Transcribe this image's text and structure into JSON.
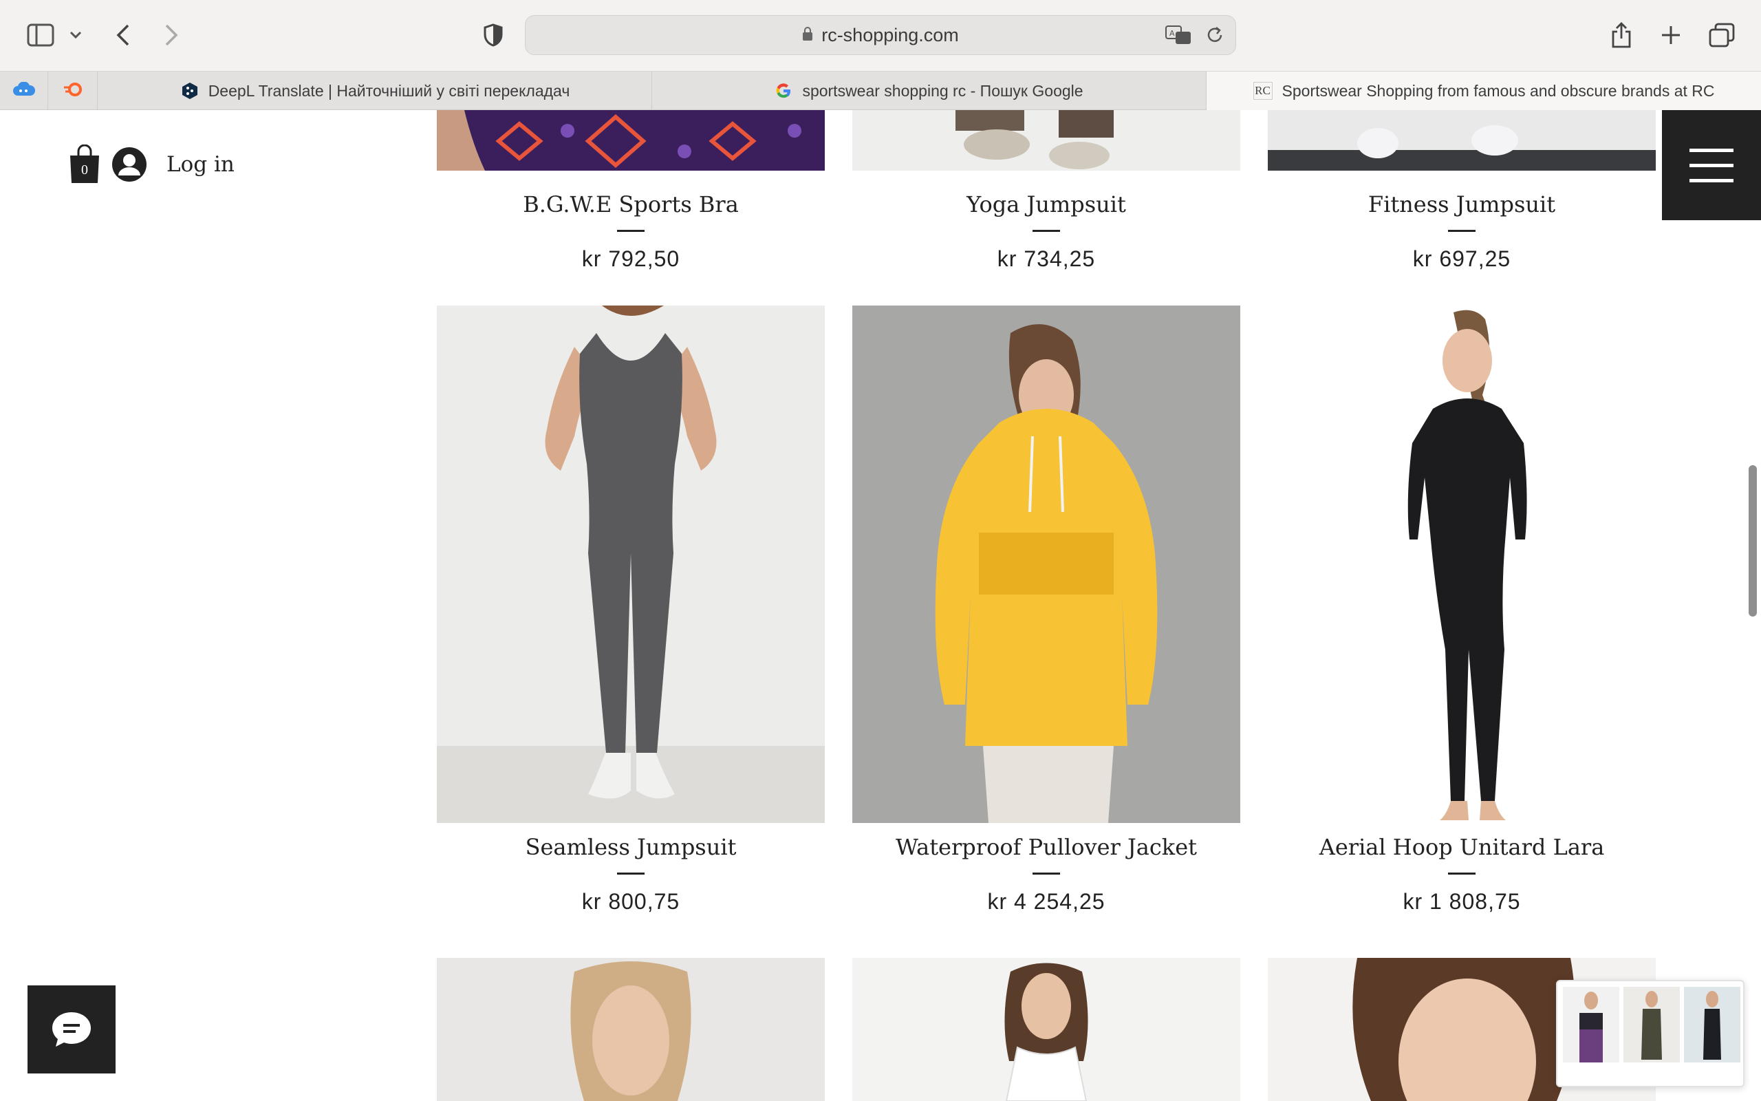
{
  "browser": {
    "url": "rc-shopping.com",
    "tabs": [
      {
        "title": "DeepL Translate | Найточніший у світі перекладач",
        "favicon": "deepl-icon"
      },
      {
        "title": "sportswear shopping rc - Пошук Google",
        "favicon": "google-icon"
      },
      {
        "title": "Sportswear Shopping from famous and obscure brands at RC",
        "favicon": "rc-icon"
      }
    ],
    "rc_favicon_text": "RC"
  },
  "header": {
    "cart_count": "0",
    "login_label": "Log in"
  },
  "products_row1": [
    {
      "name": "B.G.W.E Sports Bra",
      "price": "kr 792,50"
    },
    {
      "name": "Yoga Jumpsuit",
      "price": "kr 734,25"
    },
    {
      "name": "Fitness Jumpsuit",
      "price": "kr 697,25"
    }
  ],
  "products_row2": [
    {
      "name": "Seamless Jumpsuit",
      "price": "kr 800,75"
    },
    {
      "name": "Waterproof Pullover Jacket",
      "price": "kr 4 254,25"
    },
    {
      "name": "Aerial Hoop Unitard Lara",
      "price": "kr 1 808,75"
    }
  ],
  "colors": {
    "text": "#222222",
    "header_button_bg": "#222222",
    "jacket_yellow": "#f7c234"
  }
}
